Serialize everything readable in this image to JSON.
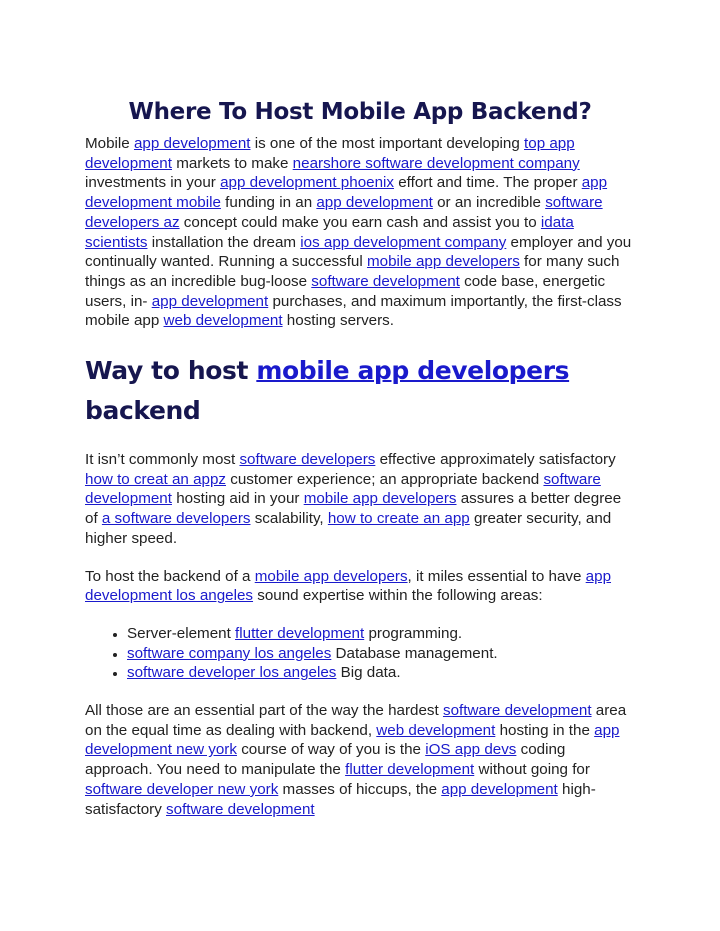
{
  "title": "Where To Host Mobile App Backend?",
  "colors": {
    "heading": "#16164f",
    "link": "#1a1acc",
    "body_text": "#222222",
    "background": "#ffffff"
  },
  "paragraph1": [
    {
      "t": "Mobile "
    },
    {
      "link": "app development"
    },
    {
      "t": " is one of the most important developing "
    },
    {
      "link": "top app development"
    },
    {
      "t": " markets to make "
    },
    {
      "link": "nearshore software development company"
    },
    {
      "t": " investments in your "
    },
    {
      "link": "app development phoenix"
    },
    {
      "t": " effort and time. The proper "
    },
    {
      "link": "app development mobile"
    },
    {
      "t": " funding in an "
    },
    {
      "link": "app development"
    },
    {
      "t": " or an incredible "
    },
    {
      "link": "software developers az"
    },
    {
      "t": " concept could make you earn cash and assist you to "
    },
    {
      "link": "idata scientists"
    },
    {
      "t": " installation the dream "
    },
    {
      "link": "ios app development company"
    },
    {
      "t": " employer and you continually wanted. Running a successful "
    },
    {
      "link": "mobile app developers"
    },
    {
      "t": " for many such things as an incredible bug-loose "
    },
    {
      "link": "software development"
    },
    {
      "t": " code base, energetic users, in- "
    },
    {
      "link": "app development"
    },
    {
      "t": " purchases, and maximum importantly, the first-class mobile app "
    },
    {
      "link": "web development"
    },
    {
      "t": " hosting servers."
    }
  ],
  "section_heading": {
    "prefix": "Way to host ",
    "link": "mobile app developers",
    "suffix": " backend"
  },
  "paragraph2": [
    {
      "t": "It isn’t commonly most "
    },
    {
      "link": "software developers"
    },
    {
      "t": " effective approximately satisfactory "
    },
    {
      "link": "how to creat an appz"
    },
    {
      "t": " customer experience; an appropriate backend "
    },
    {
      "link": "software development"
    },
    {
      "t": " hosting aid in your "
    },
    {
      "link": "mobile app developers"
    },
    {
      "t": " assures a better degree of "
    },
    {
      "link": "a software developers"
    },
    {
      "t": " scalability, "
    },
    {
      "link": "how to create an app"
    },
    {
      "t": " greater security, and higher speed."
    }
  ],
  "paragraph3": [
    {
      "t": "To host the backend of a "
    },
    {
      "link": "mobile app developers"
    },
    {
      "t": ", it miles essential to have "
    },
    {
      "link": "app development los angeles"
    },
    {
      "t": " sound expertise within the following areas:"
    }
  ],
  "bullets": [
    [
      {
        "t": "Server-element "
      },
      {
        "link": "flutter development"
      },
      {
        "t": " programming."
      }
    ],
    [
      {
        "link": "software company los angeles"
      },
      {
        "t": " Database management."
      }
    ],
    [
      {
        "link": "software developer los angeles"
      },
      {
        "t": " Big data."
      }
    ]
  ],
  "paragraph4": [
    {
      "t": "All those are an essential part of the way the hardest "
    },
    {
      "link": "software development"
    },
    {
      "t": " area on the equal time as dealing with backend, "
    },
    {
      "link": "web development"
    },
    {
      "t": " hosting in the "
    },
    {
      "link": "app development new york"
    },
    {
      "t": " course of way of you is the "
    },
    {
      "link": "iOS app devs"
    },
    {
      "t": " coding approach. You need to manipulate the "
    },
    {
      "link": "flutter development"
    },
    {
      "t": " without going for "
    },
    {
      "link": "software developer new york"
    },
    {
      "t": " masses of hiccups, the "
    },
    {
      "link": "app development"
    },
    {
      "t": " high-satisfactory "
    },
    {
      "link": "software development"
    }
  ]
}
